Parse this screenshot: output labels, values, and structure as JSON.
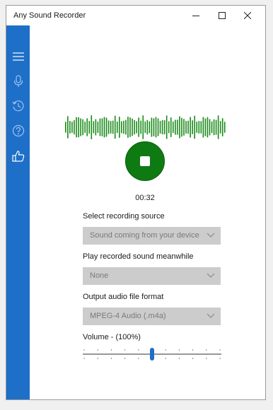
{
  "window": {
    "title": "Any Sound Recorder"
  },
  "sidebar": {
    "items": [
      {
        "icon": "hamburger-menu-icon"
      },
      {
        "icon": "microphone-icon"
      },
      {
        "icon": "history-icon"
      },
      {
        "icon": "help-icon"
      },
      {
        "icon": "thumbs-up-icon"
      }
    ]
  },
  "recorder": {
    "timer": "00:32",
    "state": "recording",
    "accent_color": "#0e7a12",
    "waveform_color": "#1a8a1a"
  },
  "settings": {
    "source_label": "Select recording source",
    "source_value": "Sound coming from your device",
    "playback_label": "Play recorded sound meanwhile",
    "playback_value": "None",
    "format_label": "Output audio file format",
    "format_value": "MPEG-4 Audio (.m4a)",
    "volume_label": "Volume - (100%)",
    "volume_percent": 100
  },
  "colors": {
    "sidebar": "#1e6fc8",
    "slider_thumb": "#1e6fc8"
  }
}
